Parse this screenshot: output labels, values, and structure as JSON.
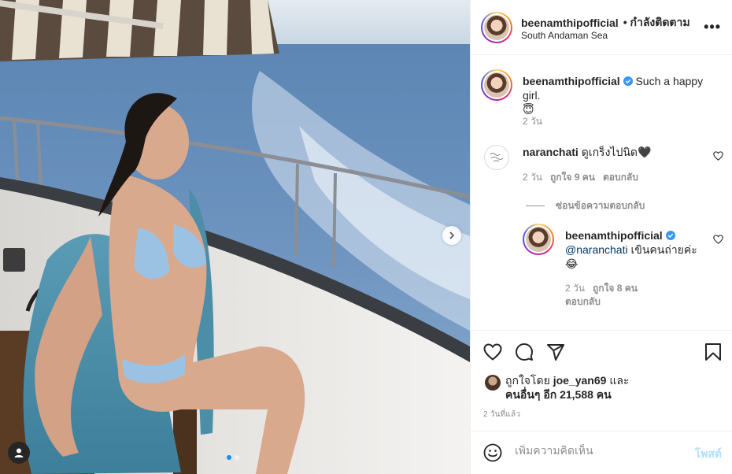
{
  "post": {
    "author": "beenamthipofficial",
    "follow_status": "• กำลังติดตาม",
    "location": "South Andaman Sea",
    "more_glyph": "•••",
    "caption_text": "Such a happy girl.",
    "caption_emoji": "😇",
    "caption_age": "2 วัน"
  },
  "comments": [
    {
      "username": "naranchati",
      "text": "ดูเกร็งไปนิด🖤",
      "age": "2 วัน",
      "likes": "ถูกใจ 9 คน",
      "reply_label": "ตอบกลับ",
      "hide_replies": "ซ่อนข้อความตอบกลับ",
      "reply": {
        "username": "beenamthipofficial",
        "mention": "@naranchati",
        "text": "เขินคนถ่ายค่ะ",
        "emoji": "😂",
        "age": "2 วัน",
        "likes": "ถูกใจ 8 คน",
        "reply_label": "ตอบกลับ"
      }
    }
  ],
  "likes": {
    "prefix": "ถูกใจโดย",
    "user": "joe_yan69",
    "and": "และ",
    "others": "คนอื่นๆ อีก 21,588 คน"
  },
  "timestamp": "2 วันที่แล้ว",
  "add_comment": {
    "placeholder": "เพิ่มความคิดเห็น",
    "post_label": "โพสต์"
  },
  "carousel": {
    "count": 2,
    "active_index": 0
  },
  "colors": {
    "verified": "#3897f0",
    "post_disabled": "#b2dffc",
    "meta": "#8e8e8e"
  }
}
